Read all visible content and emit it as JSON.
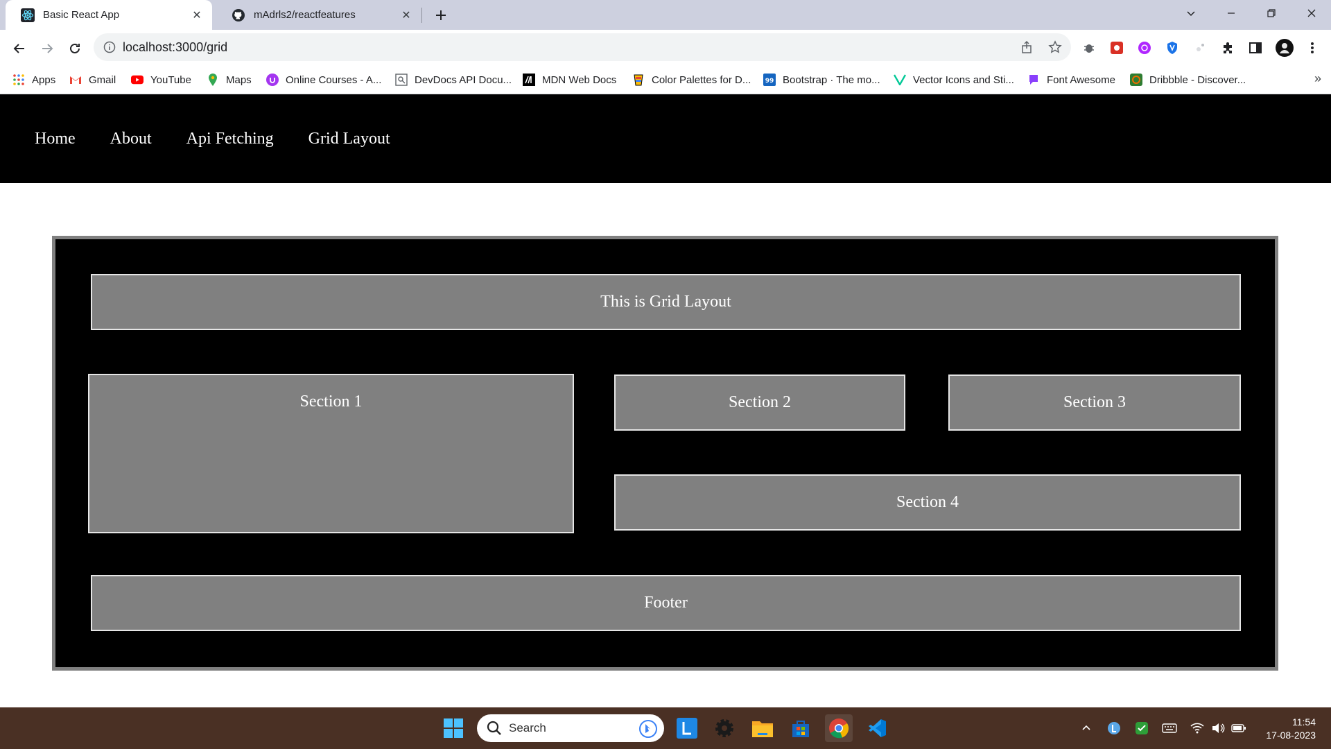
{
  "browser": {
    "tabs": [
      {
        "title": "Basic React App",
        "favicon": "react-icon",
        "active": true
      },
      {
        "title": "mAdrls2/reactfeatures",
        "favicon": "github-icon",
        "active": false
      }
    ],
    "address": "localhost:3000/grid",
    "bookmarks": [
      {
        "label": "Apps",
        "icon": "apps-grid-icon"
      },
      {
        "label": "Gmail",
        "icon": "gmail-icon"
      },
      {
        "label": "YouTube",
        "icon": "youtube-icon"
      },
      {
        "label": "Maps",
        "icon": "maps-icon"
      },
      {
        "label": "Online Courses - A...",
        "icon": "courses-icon"
      },
      {
        "label": "DevDocs API Docu...",
        "icon": "devdocs-icon"
      },
      {
        "label": "MDN Web Docs",
        "icon": "mdn-icon"
      },
      {
        "label": "Color Palettes for D...",
        "icon": "palette-icon"
      },
      {
        "label": "Bootstrap · The mo...",
        "icon": "bootstrap-icon"
      },
      {
        "label": "Vector Icons and Sti...",
        "icon": "vector-icon"
      },
      {
        "label": "Font Awesome",
        "icon": "fontawesome-icon"
      },
      {
        "label": "Dribbble - Discover...",
        "icon": "dribbble-icon"
      }
    ]
  },
  "page": {
    "nav": [
      "Home",
      "About",
      "Api Fetching",
      "Grid Layout"
    ],
    "grid": {
      "header": "This is Grid Layout",
      "section1": "Section 1",
      "section2": "Section 2",
      "section3": "Section 3",
      "section4": "Section 4",
      "footer": "Footer"
    }
  },
  "taskbar": {
    "search_placeholder": "Search",
    "time": "11:54",
    "date": "17-08-2023"
  },
  "colors": {
    "nav_bg": "#000000",
    "grid_cell": "#808080",
    "taskbar": "#4a3024",
    "tabstrip": "#cdd0df"
  }
}
